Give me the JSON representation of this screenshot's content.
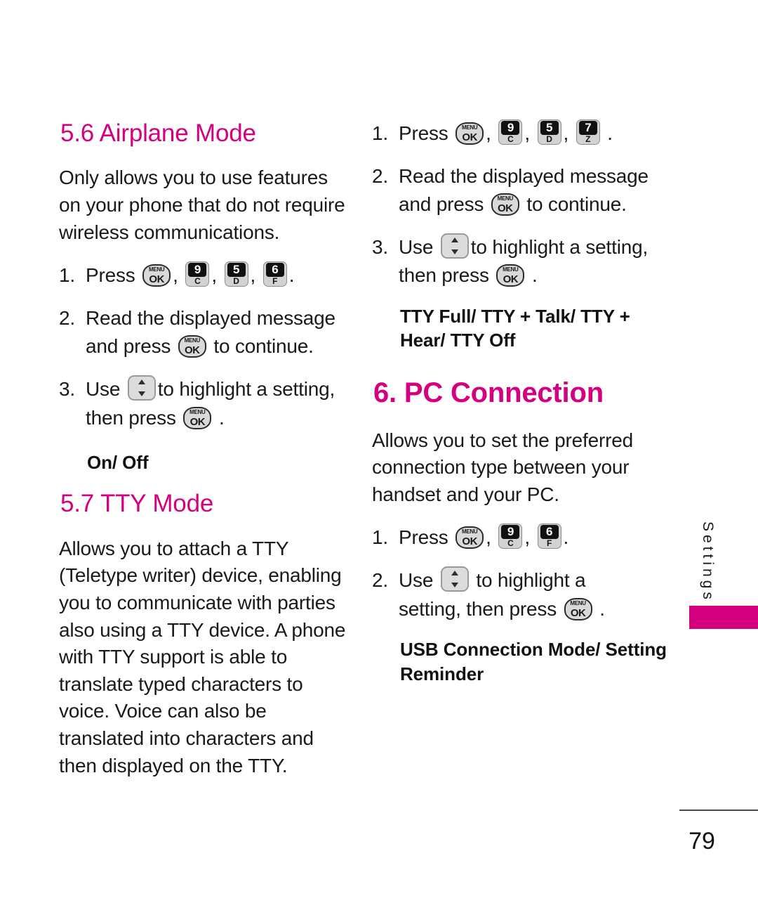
{
  "document": {
    "page_number": "79",
    "side_tab_label": "Settings",
    "accent_color": "#d5007f"
  },
  "icons": {
    "menu_ok": {
      "top": "MENU",
      "bottom": "OK",
      "name": "menu-ok-key-icon"
    },
    "key_9c": {
      "digit": "9",
      "letter": "C"
    },
    "key_5d": {
      "digit": "5",
      "letter": "D"
    },
    "key_6f": {
      "digit": "6",
      "letter": "F"
    },
    "key_7z": {
      "digit": "7",
      "letter": "Z"
    },
    "nav_updown": {
      "name": "navigation-up-down-key-icon"
    }
  },
  "left_column": {
    "airplane": {
      "heading": "5.6 Airplane Mode",
      "intro": "Only allows you to use features on your phone that do not require wireless communications.",
      "steps": [
        {
          "number": "1.",
          "before": "Press",
          "keys": [
            "menu_ok",
            "key_9c",
            "key_5d",
            "key_6f"
          ],
          "after": "."
        },
        {
          "number": "2.",
          "line1": "Read the displayed message",
          "line2_before": "and press",
          "line2_after": "to continue."
        },
        {
          "number": "3.",
          "line1_before": "Use",
          "line1_after": "to highlight a setting,",
          "line2_before": "then press",
          "line2_after": "."
        }
      ],
      "options": "On/ Off"
    },
    "tty": {
      "heading": "5.7 TTY Mode",
      "intro": "Allows you to attach a TTY (Teletype writer) device, enabling you to communicate with parties also using a TTY device. A phone with TTY support is able to translate typed characters to voice. Voice can also be translated into characters and then displayed on the TTY."
    }
  },
  "right_column": {
    "tty_steps": {
      "steps": [
        {
          "number": "1.",
          "before": "Press",
          "keys": [
            "menu_ok",
            "key_9c",
            "key_5d",
            "key_7z"
          ],
          "after": "."
        },
        {
          "number": "2.",
          "line1": "Read the displayed message",
          "line2_before": "and press",
          "line2_after": "to continue."
        },
        {
          "number": "3.",
          "line1_before": "Use",
          "line1_after": "to highlight a setting,",
          "line2_before": "then press",
          "line2_after": "."
        }
      ],
      "options": "TTY Full/ TTY + Talk/ TTY + Hear/ TTY Off"
    },
    "pc_connection": {
      "heading": "6. PC Connection",
      "intro": "Allows you to set the preferred connection type between your handset and your PC.",
      "steps": [
        {
          "number": "1.",
          "before": "Press",
          "keys": [
            "menu_ok",
            "key_9c",
            "key_6f"
          ],
          "after": "."
        },
        {
          "number": "2.",
          "line1_before": "Use",
          "line1_after": "to highlight a",
          "line2_before": "setting, then press",
          "line2_after": "."
        }
      ],
      "options": "USB Connection Mode/ Setting Reminder"
    }
  }
}
